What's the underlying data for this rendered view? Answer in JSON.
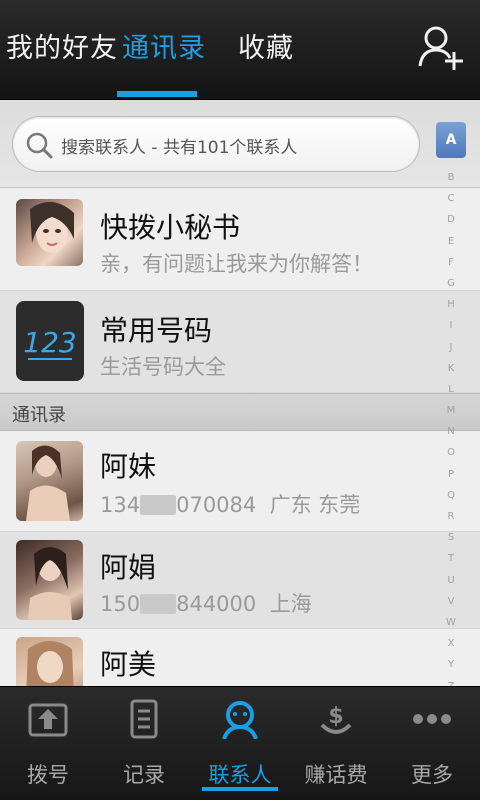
{
  "top_tabs": [
    {
      "label": "我的好友"
    },
    {
      "label": "通讯录",
      "active": true
    },
    {
      "label": "收藏"
    }
  ],
  "search": {
    "placeholder": "搜索联系人 - 共有101个联系人"
  },
  "index": {
    "active": "A",
    "letters": [
      "B",
      "C",
      "D",
      "E",
      "F",
      "G",
      "H",
      "I",
      "J",
      "K",
      "L",
      "M",
      "N",
      "O",
      "P",
      "Q",
      "R",
      "S",
      "T",
      "U",
      "V",
      "W",
      "X",
      "Y",
      "Z"
    ]
  },
  "pinned": [
    {
      "name": "快拨小秘书",
      "subtitle": "亲，有问题让我来为你解答！",
      "avatar": "photo"
    },
    {
      "name": "常用号码",
      "subtitle": "生活号码大全",
      "avatar": "123"
    }
  ],
  "section": {
    "label": "通讯录"
  },
  "contacts": [
    {
      "name": "阿妹",
      "phone_prefix": "134",
      "phone_suffix": "070084",
      "location": "广东 东莞"
    },
    {
      "name": "阿娟",
      "phone_prefix": "150",
      "phone_suffix": "844000",
      "location": "上海"
    },
    {
      "name": "阿美",
      "phone_prefix": "",
      "phone_suffix": "",
      "location": ""
    }
  ],
  "bottom_nav": [
    {
      "label": "拨号",
      "icon": "dialpad-icon"
    },
    {
      "label": "记录",
      "icon": "call-log-icon"
    },
    {
      "label": "联系人",
      "icon": "contacts-icon",
      "active": true
    },
    {
      "label": "赚话费",
      "icon": "earn-credit-icon"
    },
    {
      "label": "更多",
      "icon": "more-icon"
    }
  ],
  "colors": {
    "accent": "#1a9fe3",
    "topbar": "#1f1f1f",
    "list_bg": "#efefef"
  }
}
